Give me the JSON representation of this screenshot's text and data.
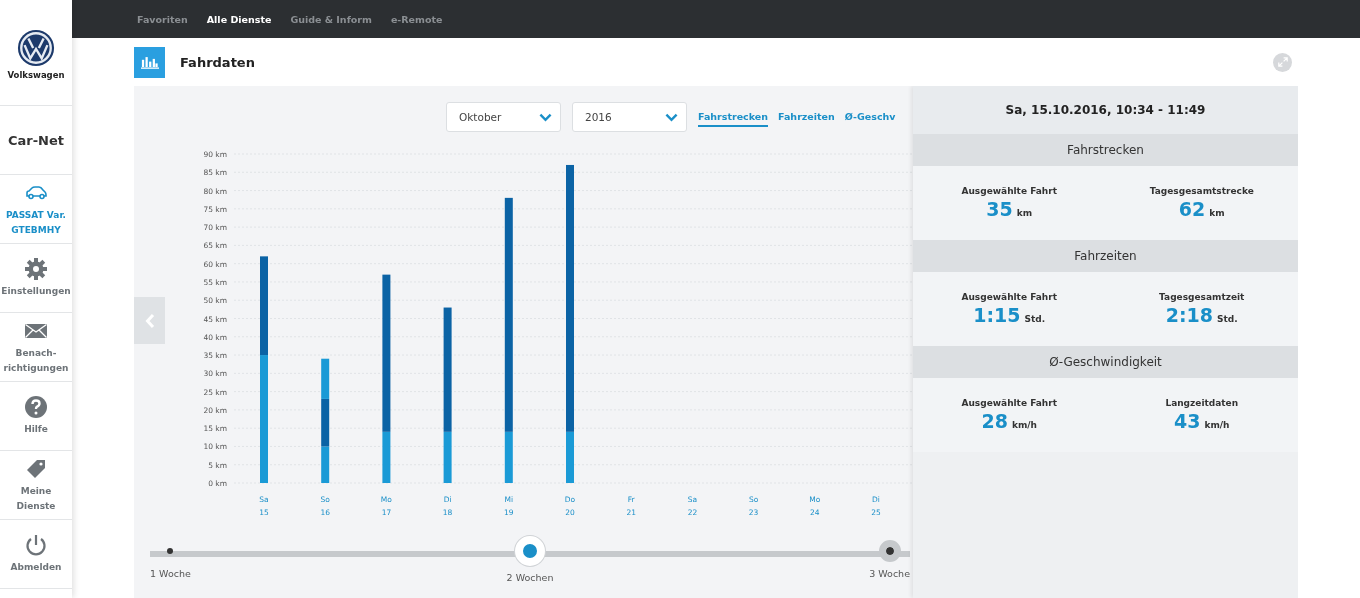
{
  "sidebar": {
    "brand": "Volkswagen",
    "app_title": "Car-Net",
    "items": [
      {
        "kind": "car",
        "label": "PASSAT Var. GTEBMHY",
        "selected": true
      },
      {
        "kind": "gear",
        "label": "Einstellungen",
        "selected": false
      },
      {
        "kind": "mail",
        "label": "Benach-richtigungen",
        "selected": false
      },
      {
        "kind": "help",
        "label": "Hilfe",
        "selected": false
      },
      {
        "kind": "tag",
        "label": "Meine Dienste",
        "selected": false
      },
      {
        "kind": "power",
        "label": "Abmelden",
        "selected": false
      }
    ]
  },
  "top_nav": [
    {
      "label": "Favoriten",
      "selected": false
    },
    {
      "label": "Alle Dienste",
      "selected": true
    },
    {
      "label": "Guide & Inform",
      "selected": false
    },
    {
      "label": "e-Remote",
      "selected": false
    }
  ],
  "page": {
    "title": "Fahrdaten"
  },
  "filters": [
    {
      "value": "Oktober"
    },
    {
      "value": "2016"
    }
  ],
  "tabs": [
    {
      "label": "Fahrstrecken",
      "selected": true
    },
    {
      "label": "Fahrzeiten",
      "selected": false
    },
    {
      "label": "Ø-Geschv",
      "selected": false
    }
  ],
  "chart_data": {
    "type": "bar",
    "stacked": true,
    "grid": true,
    "categories": [
      "Sa 15",
      "So 16",
      "Mo 17",
      "Di 18",
      "Mi 19",
      "Do 20",
      "Fr 21",
      "Sa 22",
      "So 23",
      "Mo 24",
      "Di 25"
    ],
    "series": [
      {
        "color": "#1a9ad6",
        "values": [
          35,
          10,
          14,
          14,
          14,
          14,
          null,
          null,
          null,
          null,
          null
        ]
      },
      {
        "color": "#0b63a5",
        "values": [
          27,
          13,
          43,
          34,
          64,
          73,
          null,
          null,
          null,
          null,
          null
        ]
      },
      {
        "color": "#1a9ad6",
        "values": [
          null,
          11,
          null,
          null,
          null,
          null,
          null,
          null,
          null,
          null,
          null
        ]
      }
    ],
    "ylim": [
      0,
      90
    ],
    "yticks": [
      {
        "value": 0,
        "label": "0 km"
      },
      {
        "value": 5,
        "label": "5 km"
      },
      {
        "value": 10,
        "label": "10 km"
      },
      {
        "value": 15,
        "label": "15 km"
      },
      {
        "value": 20,
        "label": "20 km"
      },
      {
        "value": 25,
        "label": "25 km"
      },
      {
        "value": 30,
        "label": "30 km"
      },
      {
        "value": 35,
        "label": "35 km"
      },
      {
        "value": 40,
        "label": "40 km"
      },
      {
        "value": 45,
        "label": "45 km"
      },
      {
        "value": 50,
        "label": "50 km"
      },
      {
        "value": 55,
        "label": "55 km"
      },
      {
        "value": 60,
        "label": "60 km"
      },
      {
        "value": 65,
        "label": "65 km"
      },
      {
        "value": 70,
        "label": "70 km"
      },
      {
        "value": 75,
        "label": "75 km"
      },
      {
        "value": 80,
        "label": "80 km"
      },
      {
        "value": 85,
        "label": "85 km"
      },
      {
        "value": 90,
        "label": "90 km"
      }
    ]
  },
  "range_slider": {
    "stops": [
      {
        "label": "1 Woche",
        "selected": false
      },
      {
        "label": "2 Wochen",
        "selected": true
      },
      {
        "label": "3 Woche",
        "selected": false
      }
    ]
  },
  "detail_panel": {
    "title": "Sa, 15.10.2016, 10:34 - 11:49",
    "sections": [
      {
        "title": "Fahrstrecken",
        "metrics": [
          {
            "label": "Ausgewählte Fahrt",
            "value": "35",
            "unit": "km"
          },
          {
            "label": "Tagesgesamtstrecke",
            "value": "62",
            "unit": "km"
          }
        ]
      },
      {
        "title": "Fahrzeiten",
        "metrics": [
          {
            "label": "Ausgewählte Fahrt",
            "value": "1:15",
            "unit": "Std."
          },
          {
            "label": "Tagesgesamtzeit",
            "value": "2:18",
            "unit": "Std."
          }
        ]
      },
      {
        "title": "Ø-Geschwindigkeit",
        "metrics": [
          {
            "label": "Ausgewählte Fahrt",
            "value": "28",
            "unit": "km/h"
          },
          {
            "label": "Langzeitdaten",
            "value": "43",
            "unit": "km/h"
          }
        ]
      }
    ]
  }
}
